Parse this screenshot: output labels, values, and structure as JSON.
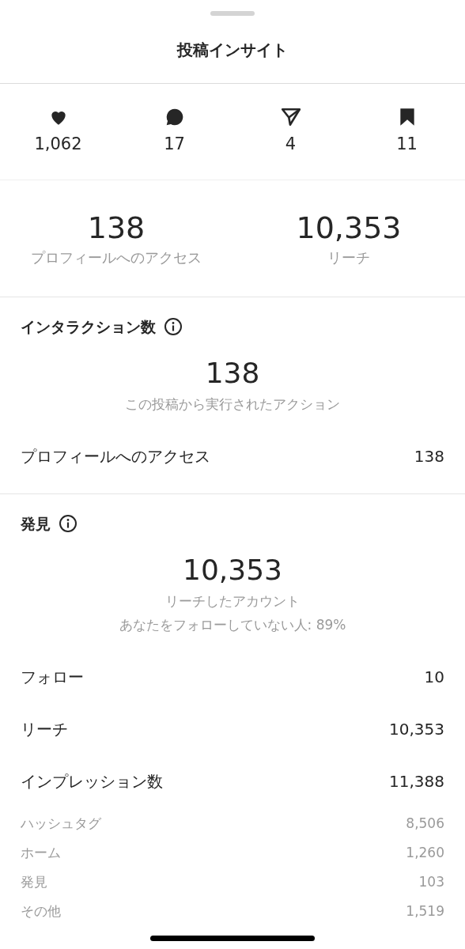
{
  "title": "投稿インサイト",
  "engagement": [
    {
      "kind": "like",
      "value": "1,062"
    },
    {
      "kind": "comment",
      "value": "17"
    },
    {
      "kind": "share",
      "value": "4"
    },
    {
      "kind": "save",
      "value": "11"
    }
  ],
  "summary": [
    {
      "value": "138",
      "label": "プロフィールへのアクセス"
    },
    {
      "value": "10,353",
      "label": "リーチ"
    }
  ],
  "sections": [
    {
      "title": "インタラクション数",
      "total": "138",
      "captions": [
        "この投稿から実行されたアクション"
      ],
      "rows": [
        {
          "kind": "main",
          "label": "プロフィールへのアクセス",
          "value": "138"
        }
      ]
    },
    {
      "title": "発見",
      "total": "10,353",
      "captions": [
        "リーチしたアカウント",
        "あなたをフォローしていない人: 89%"
      ],
      "rows": [
        {
          "kind": "main",
          "label": "フォロー",
          "value": "10"
        },
        {
          "kind": "main",
          "label": "リーチ",
          "value": "10,353"
        },
        {
          "kind": "main",
          "label": "インプレッション数",
          "value": "11,388"
        },
        {
          "kind": "sub",
          "label": "ハッシュタグ",
          "value": "8,506"
        },
        {
          "kind": "sub",
          "label": "ホーム",
          "value": "1,260"
        },
        {
          "kind": "sub",
          "label": "発見",
          "value": "103"
        },
        {
          "kind": "sub",
          "label": "その他",
          "value": "1,519"
        }
      ]
    }
  ]
}
